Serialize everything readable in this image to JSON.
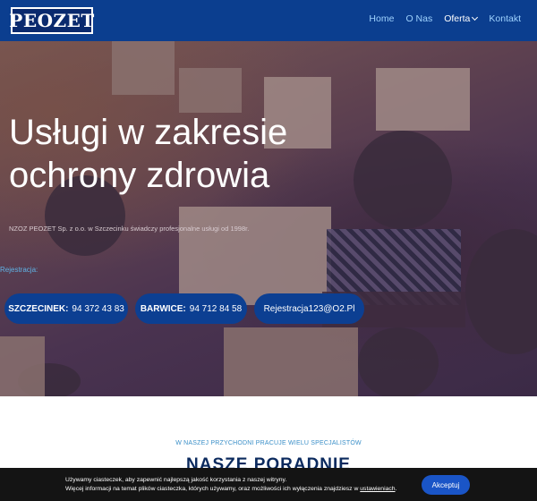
{
  "header": {
    "logo_text": "PEOZET",
    "nav": [
      {
        "label": "Home"
      },
      {
        "label": "O Nas"
      },
      {
        "label": "Oferta"
      },
      {
        "label": "Kontakt"
      }
    ]
  },
  "hero": {
    "title": "Usługi w zakresie ochrony zdrowia",
    "subtitle": "NZOZ PEOZET Sp. z o.o. w Szczecinku świadczy profesjonalne usługi od 1998r.",
    "registration_label": "Rejestracja:",
    "buttons": [
      {
        "label": "SZCZECINEK:",
        "value": "94 372 43 83"
      },
      {
        "label": "BARWICE:",
        "value": "94 712 84 58"
      },
      {
        "label": "",
        "value": "Rejestracja123@O2.Pl"
      }
    ]
  },
  "section": {
    "tagline": "W NASZEJ PRZYCHODNI PRACUJE WIELU SPECJALISTÓW",
    "title": "NASZE PORADNIE"
  },
  "cookie": {
    "line1": "Używamy ciasteczek, aby zapewnić najlepszą jakość korzystania z naszej witryny.",
    "line2": "Więcej informacji na temat plików ciasteczka, których używamy, oraz możliwości ich wyłączenia znajdziesz w",
    "link": "ustawieniach",
    "button": "Akceptuj"
  },
  "colors": {
    "header_bg": "#0b3e8f",
    "button_bg": "#0c3f92",
    "accent_link": "#9fd3ff",
    "cookie_button": "#1a55c7"
  }
}
